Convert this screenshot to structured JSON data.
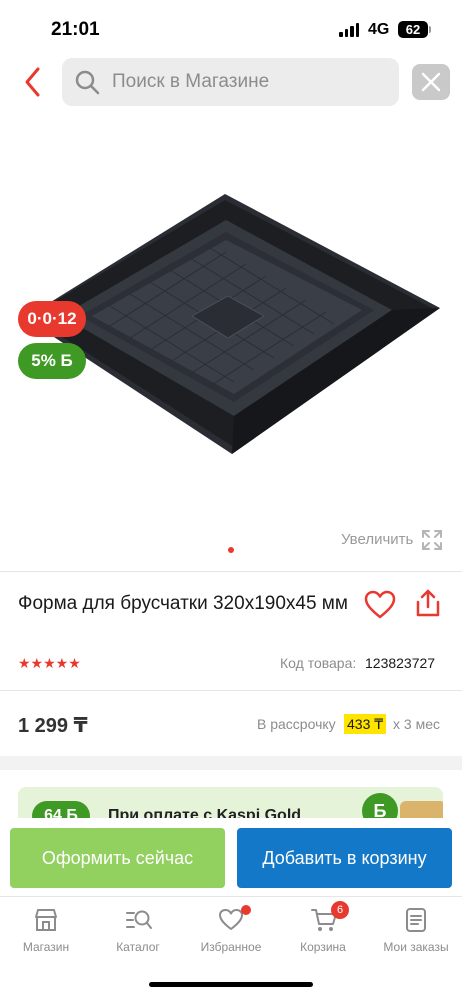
{
  "status_bar": {
    "time": "21:01",
    "network": "4G",
    "battery": "62"
  },
  "search": {
    "placeholder": "Поиск в Магазине"
  },
  "product": {
    "promo_badge": "0·0·12",
    "bonus_badge": "5% Б",
    "zoom_label": "Увеличить",
    "title": "Форма для брусчатки 320х190х45 мм",
    "rating_stars": "★★★★★",
    "sku_label": "Код товара:",
    "sku_value": "123823727",
    "price": "1 299 ₸",
    "installment_label": "В рассрочку",
    "installment_amount": "433 ₸",
    "installment_term": "х 3 мес"
  },
  "gold_banner": {
    "bonus": "64 Б",
    "text": "При оплате с Kaspi Gold",
    "coin": "Б"
  },
  "actions": {
    "buy_now": "Оформить сейчас",
    "add_to_cart": "Добавить в корзину"
  },
  "tabs": [
    {
      "label": "Магазин",
      "icon": "store-icon"
    },
    {
      "label": "Каталог",
      "icon": "catalog-search-icon"
    },
    {
      "label": "Избранное",
      "icon": "heart-icon"
    },
    {
      "label": "Корзина",
      "icon": "cart-icon",
      "badge": "6"
    },
    {
      "label": "Мои заказы",
      "icon": "orders-icon"
    }
  ],
  "colors": {
    "accent_red": "#e8392f",
    "bonus_green": "#3f9a25",
    "buy_now_green": "#92d05f",
    "cart_blue": "#1378c8",
    "installment_yellow": "#ffe400"
  }
}
